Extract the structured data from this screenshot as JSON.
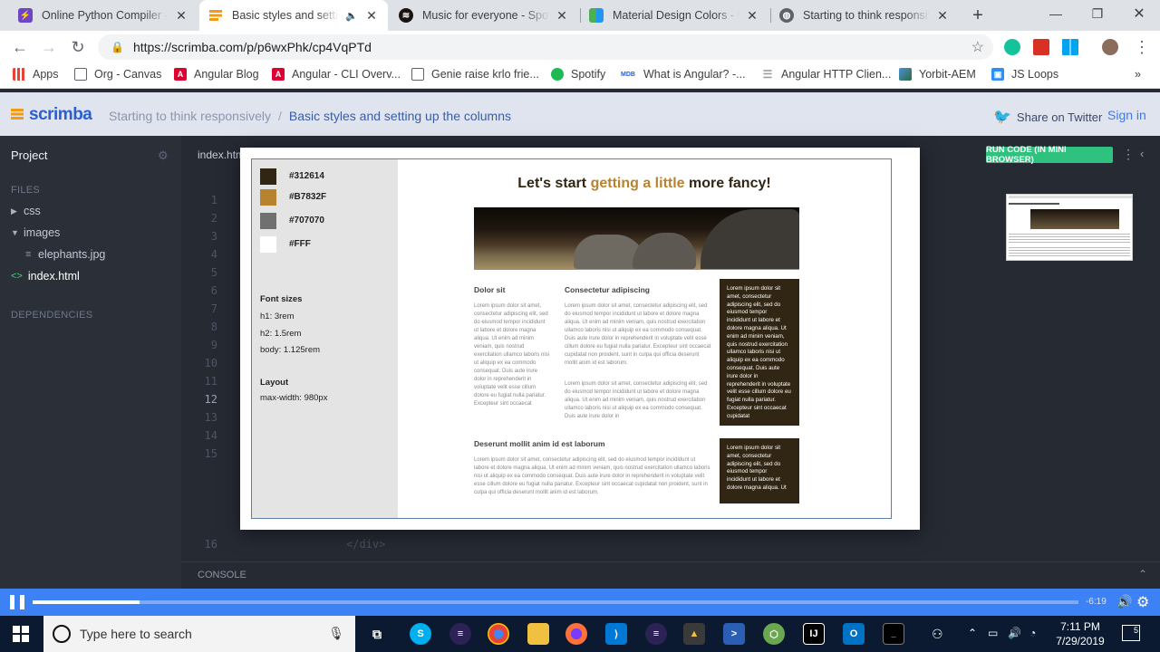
{
  "browser": {
    "tabs": [
      {
        "title": "Online Python Compiler - o",
        "active": false
      },
      {
        "title": "Basic styles and setting",
        "active": true
      },
      {
        "title": "Music for everyone - Spotif",
        "active": false
      },
      {
        "title": "Material Design Colors - M",
        "active": false
      },
      {
        "title": "Starting to think responsive",
        "active": false
      }
    ],
    "new_tab": "+",
    "url": "https://scrimba.com/p/p6wxPhk/cp4VqPTd",
    "bookmarks": [
      {
        "label": "Apps"
      },
      {
        "label": "Org - Canvas"
      },
      {
        "label": "Angular Blog"
      },
      {
        "label": "Angular - CLI Overv..."
      },
      {
        "label": "Genie raise krlo frie..."
      },
      {
        "label": "Spotify"
      },
      {
        "label": "What is Angular? -..."
      },
      {
        "label": "Angular HTTP Clien..."
      },
      {
        "label": "Yorbit-AEM"
      },
      {
        "label": "JS Loops"
      }
    ],
    "bookmarks_more": "»"
  },
  "scrimba": {
    "logo": "scrimba",
    "breadcrumb_course": "Starting to think responsively",
    "breadcrumb_sep": "/",
    "breadcrumb_lesson": "Basic styles and setting up the columns",
    "share": "Share on Twitter",
    "signin": "Sign in"
  },
  "sidebar": {
    "project": "Project",
    "files_header": "FILES",
    "items": [
      {
        "label": "css"
      },
      {
        "label": "images"
      },
      {
        "label": "elephants.jpg"
      },
      {
        "label": "index.html"
      }
    ],
    "deps_header": "DEPENDENCIES"
  },
  "editor": {
    "tab": "index.html",
    "line_numbers": [
      "1",
      "2",
      "3",
      "4",
      "5",
      "6",
      "7",
      "8",
      "9",
      "10",
      "11",
      "12",
      "13",
      "14",
      "15",
      "16"
    ],
    "line16_code": "</div>",
    "run_button": "RUN CODE (IN MINI BROWSER)",
    "console": "CONSOLE"
  },
  "preview": {
    "swatches": [
      {
        "label": "#312614",
        "color": "#312614"
      },
      {
        "label": "#B7832F",
        "color": "#B7832F"
      },
      {
        "label": "#707070",
        "color": "#707070"
      },
      {
        "label": "#FFF",
        "color": "#FFFFFF"
      }
    ],
    "font_sizes_title": "Font sizes",
    "font_h1": "h1: 3rem",
    "font_h2": "h2: 1.5rem",
    "font_body": "body: 1.125rem",
    "layout_title": "Layout",
    "layout_maxwidth": "max-width: 980px",
    "heading_pre": "Let's start ",
    "heading_accent": "getting a little",
    "heading_post": " more fancy!",
    "col1_title": "Dolor sit",
    "col1_text": "Lorem ipsum dolor sit amet, consectetur adipiscing elit, sed do eiusmod tempor incididunt ut labore et dolore magna aliqua. Ut enim ad minim veniam, quis nostrud exercitation ullamco laboris nisi ut aliquip ex ea commodo consequat. Duis aute irure dolor in reprehenderit in voluptate velit esse cillum dolore eu fugiat nulla pariatur. Excepteur sint occaecat",
    "col2_title": "Consectetur adipiscing",
    "col2_text1": "Lorem ipsum dolor sit amet, consectetur adipiscing elit, sed do eiusmod tempor incididunt ut labore et dolore magna aliqua. Ut enim ad minim veniam, quis nostrud exercitation ullamco laboris nisi ut aliquip ex ea commodo consequat. Duis aute irure dolor in reprehenderit in voluptate velit esse cillum dolore eu fugiat nulla pariatur. Excepteur sint occaecat cupidatat non proident, sunt in culpa qui officia deserunt mollit anim id est laborum.",
    "col2_text2": "Lorem ipsum dolor sit amet, consectetur adipiscing elit, sed do eiusmod tempor incididunt ut labore et dolore magna aliqua. Ut enim ad minim veniam, quis nostrud exercitation ullamco laboris nisi ut aliquip ex ea commodo consequat. Duis aute irure dolor in",
    "dark1_text": "Lorem ipsum dolor sit amet, consectetur adipiscing elit, sed do eiusmod tempor incididunt ut labore et dolore magna aliqua. Ut enim ad minim veniam, quis nostrud exercitation ullamco laboris nisi ut aliquip ex ea commodo consequat. Duis aute irure dolor in reprehenderit in voluptate velit esse cillum dolore eu fugiat nulla pariatur. Excepteur sint occaecat cupidatat",
    "section_title": "Deserunt mollit anim id est laborum",
    "section_text": "Lorem ipsum dolor sit amet, consectetur adipiscing elit, sed do eiusmod tempor incididunt ut labore et dolore magna aliqua. Ut enim ad minim veniam, quis nostrud exercitation ullamco laboris nisi ut aliquip ex ea commodo consequat. Duis aute irure dolor in reprehenderit in voluptate velit esse cillum dolore eu fugiat nulla pariatur. Excepteur sint occaecat cupidatat non proident, sunt in culpa qui officia deserunt mollit anim id est laborum.",
    "dark2_text": "Lorem ipsum dolor sit amet, consectetur adipiscing elit, sed do eiusmod tempor incididunt ut labore et dolore magna aliqua. Ut"
  },
  "player": {
    "time": "-6:19",
    "progress": 0.102
  },
  "taskbar": {
    "search_placeholder": "Type here to search",
    "time": "7:11 PM",
    "date": "7/29/2019",
    "notifications": "5"
  },
  "colors": {
    "scrimba_blue": "#3d82f5",
    "run_green": "#2ec27e",
    "dark_brown": "#312614",
    "gold": "#B7832F"
  }
}
